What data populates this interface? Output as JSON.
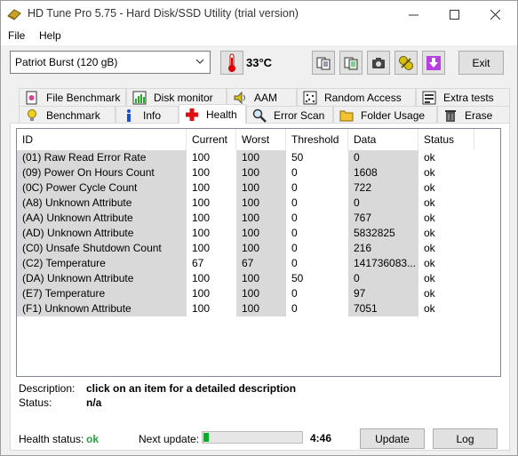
{
  "window": {
    "title": "HD Tune Pro 5.75 - Hard Disk/SSD Utility (trial version)",
    "controls": [
      "minimize",
      "maximize",
      "close"
    ]
  },
  "menu": [
    {
      "label": "File"
    },
    {
      "label": "Help"
    }
  ],
  "toolbar": {
    "drive": "Patriot Burst (120 gB)",
    "temperature": "33°C",
    "exit_label": "Exit"
  },
  "tabs_row1": [
    {
      "label": "File Benchmark",
      "icon": "file-benchmark-icon"
    },
    {
      "label": "Disk monitor",
      "icon": "disk-monitor-icon"
    },
    {
      "label": "AAM",
      "icon": "speaker-icon"
    },
    {
      "label": "Random Access",
      "icon": "random-access-icon"
    },
    {
      "label": "Extra tests",
      "icon": "extra-tests-icon"
    }
  ],
  "tabs_row2": [
    {
      "label": "Benchmark",
      "icon": "bulb-icon"
    },
    {
      "label": "Info",
      "icon": "info-icon"
    },
    {
      "label": "Health",
      "icon": "red-cross-icon",
      "active": true
    },
    {
      "label": "Error Scan",
      "icon": "magnifier-icon"
    },
    {
      "label": "Folder Usage",
      "icon": "folder-icon"
    },
    {
      "label": "Erase",
      "icon": "trash-icon"
    }
  ],
  "table": {
    "columns": [
      "ID",
      "Current",
      "Worst",
      "Threshold",
      "Data",
      "Status"
    ],
    "rows": [
      [
        "(01) Raw Read Error Rate",
        "100",
        "100",
        "50",
        "0",
        "ok"
      ],
      [
        "(09) Power On Hours Count",
        "100",
        "100",
        "0",
        "1608",
        "ok"
      ],
      [
        "(0C) Power Cycle Count",
        "100",
        "100",
        "0",
        "722",
        "ok"
      ],
      [
        "(A8) Unknown Attribute",
        "100",
        "100",
        "0",
        "0",
        "ok"
      ],
      [
        "(AA) Unknown Attribute",
        "100",
        "100",
        "0",
        "767",
        "ok"
      ],
      [
        "(AD) Unknown Attribute",
        "100",
        "100",
        "0",
        "5832825",
        "ok"
      ],
      [
        "(C0) Unsafe Shutdown Count",
        "100",
        "100",
        "0",
        "216",
        "ok"
      ],
      [
        "(C2) Temperature",
        "67",
        "67",
        "0",
        "141736083...",
        "ok"
      ],
      [
        "(DA) Unknown Attribute",
        "100",
        "100",
        "50",
        "0",
        "ok"
      ],
      [
        "(E7) Temperature",
        "100",
        "100",
        "0",
        "97",
        "ok"
      ],
      [
        "(F1) Unknown Attribute",
        "100",
        "100",
        "0",
        "7051",
        "ok"
      ]
    ]
  },
  "details": {
    "description_label": "Description:",
    "description_value": "click on an item for a detailed description",
    "status_label": "Status:",
    "status_value": "n/a"
  },
  "footer": {
    "health_label": "Health status:",
    "health_value": "ok",
    "next_update_label": "Next update:",
    "progress_fraction": 0.05,
    "countdown": "4:46",
    "update_label": "Update",
    "log_label": "Log"
  },
  "colors": {
    "ok_green": "#2ea043",
    "progress_green": "#06b025"
  }
}
